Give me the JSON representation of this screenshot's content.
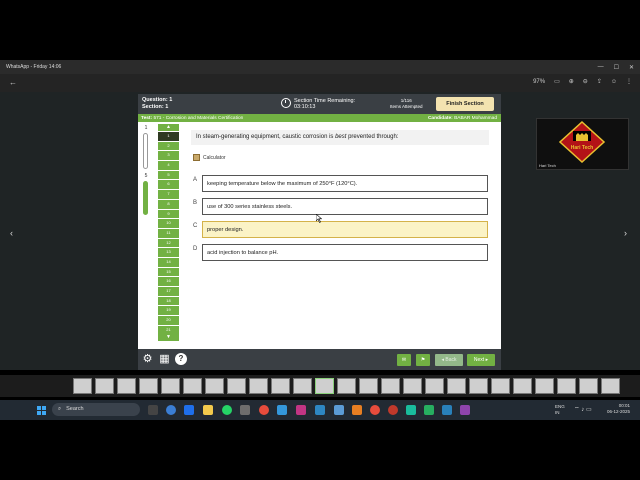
{
  "window": {
    "title": "WhatsApp - Friday 14:06",
    "min": "—",
    "max": "☐",
    "close": "✕"
  },
  "viewer": {
    "back": "←",
    "zoom": "97%"
  },
  "exam": {
    "question_label": "Question:",
    "question_value": "1",
    "section_label": "Section:",
    "section_value": "1",
    "timer_title": "Section Time Remaining:",
    "timer_value": "03:10:13",
    "attempted_count": "1/116",
    "attempted_label": "Items Attempted",
    "finish_button": "Finish Section",
    "test_prefix": "Test:",
    "test_name": "571 - Corrosion and Materials Certification",
    "candidate_prefix": "Candidate:",
    "candidate_name": "BABAR Mohammad",
    "left_counts": [
      "1",
      "5"
    ],
    "question_numbers": [
      "1",
      "2",
      "3",
      "4",
      "5",
      "6",
      "7",
      "8",
      "9",
      "10",
      "11",
      "12",
      "13",
      "14",
      "15",
      "16",
      "17",
      "18",
      "19",
      "20",
      "21"
    ],
    "question_text_pre": "In steam-generating equipment, caustic corrosion is ",
    "question_text_em": "best",
    "question_text_post": " prevented through:",
    "calculator_label": "Calculator",
    "options": [
      {
        "letter": "A",
        "text": "keeping temperature below the maximum of 250°F (120°C)."
      },
      {
        "letter": "B",
        "text": "use of 300 series stainless steels."
      },
      {
        "letter": "C",
        "text": "proper design."
      },
      {
        "letter": "D",
        "text": "acid injection to balance pH."
      }
    ],
    "selected_option": "C",
    "back_button": "◂ Back",
    "next_button": "Next ▸",
    "help_icon": "?"
  },
  "camera": {
    "caption": "Hari Tech",
    "logo_text": "Hari Tech"
  },
  "thumbnail_text": "DE",
  "taskbar": {
    "search_placeholder": "Search",
    "lang_top": "ENG",
    "lang_bottom": "IN",
    "time": "00:01",
    "date": "06-12-2025"
  },
  "colors": {
    "accent_green": "#72b143",
    "header_dark": "#3a3f44",
    "selected_yellow": "#fbf3c6"
  }
}
